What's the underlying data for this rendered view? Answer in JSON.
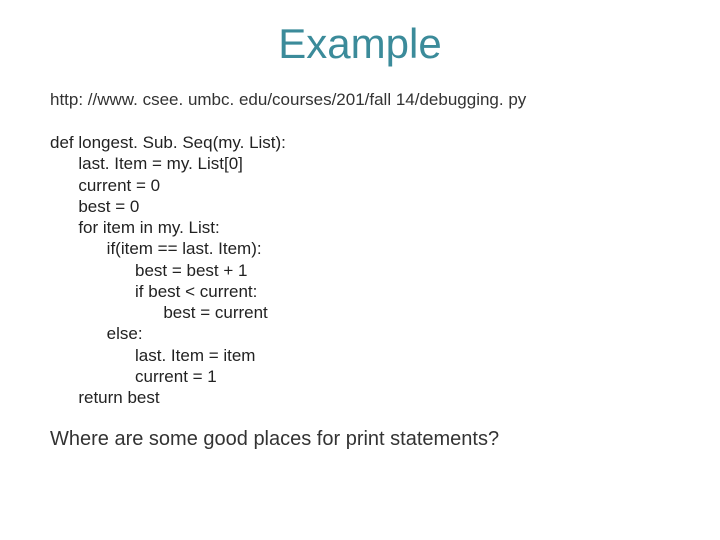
{
  "title": "Example",
  "url": "http: //www. csee. umbc. edu/courses/201/fall 14/debugging. py",
  "code": "def longest. Sub. Seq(my. List):\n      last. Item = my. List[0]\n      current = 0\n      best = 0\n      for item in my. List:\n            if(item == last. Item):\n                  best = best + 1\n                  if best < current:\n                        best = current\n            else:\n                  last. Item = item\n                  current = 1\n      return best",
  "question": "Where are some good places for print statements?"
}
